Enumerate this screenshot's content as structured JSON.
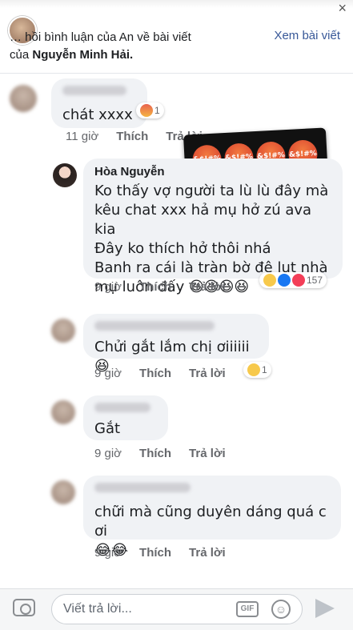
{
  "header": {
    "headline_prefix": "… hồi bình luận của An về bài viết",
    "headline_of": "của",
    "post_author": "Nguyễn Minh Hải.",
    "see_post": "Xem bài viết",
    "close": "×"
  },
  "sticker": {
    "angry_text": "&$!#%",
    "laugh_text": "😂"
  },
  "comments": [
    {
      "text": "chát xxxx",
      "time": "11 giờ",
      "like": "Thích",
      "reply": "Trả lời",
      "reaction_count": "1"
    },
    {
      "name": "Hòa Nguyễn",
      "lines": [
        "Ko thấy vợ người ta lù lù đây mà",
        "kêu chat xxx hả mụ hở zú ava kia",
        "Đây ko thích hở thôi nhá",
        "Banh ra cái là tràn bờ đê lụt nhà",
        "mụ luôn đấy 😆😆😆😆"
      ],
      "time": "9 giờ",
      "like": "Thích",
      "reply": "Trả lời",
      "reaction_count": "157"
    },
    {
      "text": "Chửi gắt lắm chị ơiiiiii 😆",
      "time": "9 giờ",
      "like": "Thích",
      "reply": "Trả lời",
      "reaction_count": "1"
    },
    {
      "text": "Gắt",
      "time": "9 giờ",
      "like": "Thích",
      "reply": "Trả lời"
    },
    {
      "text": "chữi mà cũng duyên dáng quá c ơi",
      "emoji_line": "😂😂",
      "time": "9 giờ",
      "like": "Thích",
      "reply": "Trả lời"
    }
  ],
  "composer": {
    "placeholder": "Viết trả lời...",
    "gif": "GIF",
    "smiley": "☺"
  }
}
